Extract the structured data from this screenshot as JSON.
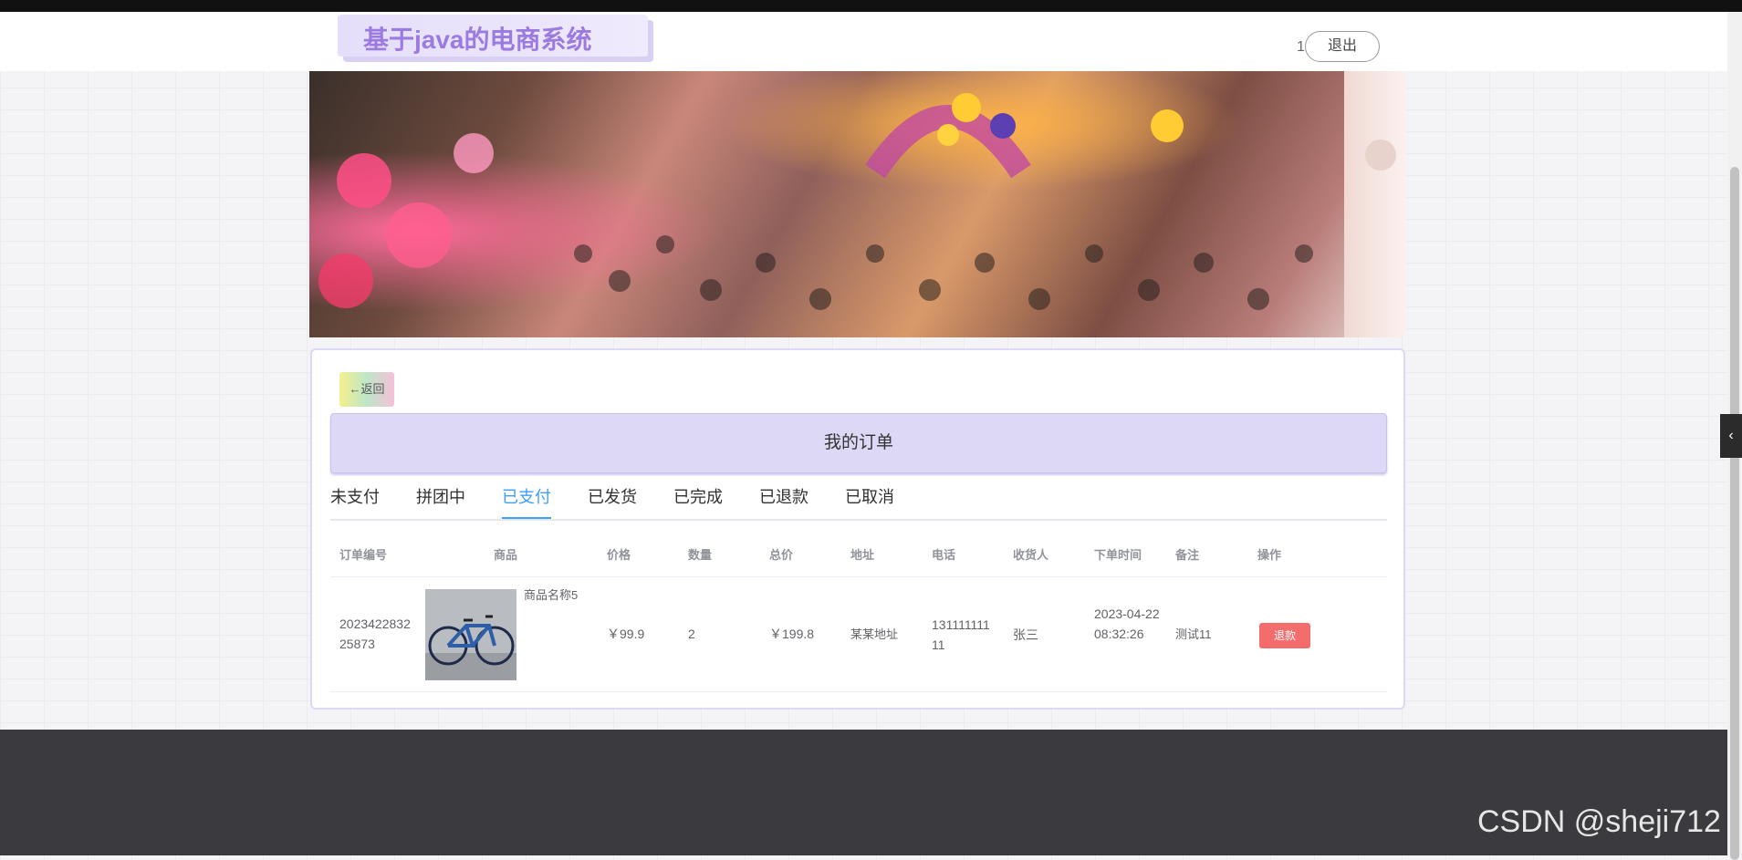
{
  "header": {
    "logo_text": "基于java的电商系统",
    "user_num": "1",
    "logout_label": "退出"
  },
  "panel": {
    "back_label": "←返回",
    "title": "我的订单",
    "tabs": [
      "未支付",
      "拼团中",
      "已支付",
      "已发货",
      "已完成",
      "已退款",
      "已取消"
    ],
    "active_tab": "已支付"
  },
  "table": {
    "headers": [
      "订单编号",
      "商品",
      "价格",
      "数量",
      "总价",
      "地址",
      "电话",
      "收货人",
      "下单时间",
      "备注",
      "操作"
    ],
    "rows": [
      {
        "order_no": "202342283225873",
        "product_name": "商品名称5",
        "price": "￥99.9",
        "quantity": "2",
        "total": "￥199.8",
        "address": "某某地址",
        "phone": "13111111111",
        "receiver": "张三",
        "order_time": "2023-04-22 08:32:26",
        "note": "测试11",
        "action_label": "退款"
      }
    ]
  },
  "watermark": "CSDN @sheji712",
  "colors": {
    "accent": "#409eff",
    "danger": "#f56c6c",
    "title_bg": "#dcd8f5",
    "footer_bg": "#3b3a3e"
  }
}
